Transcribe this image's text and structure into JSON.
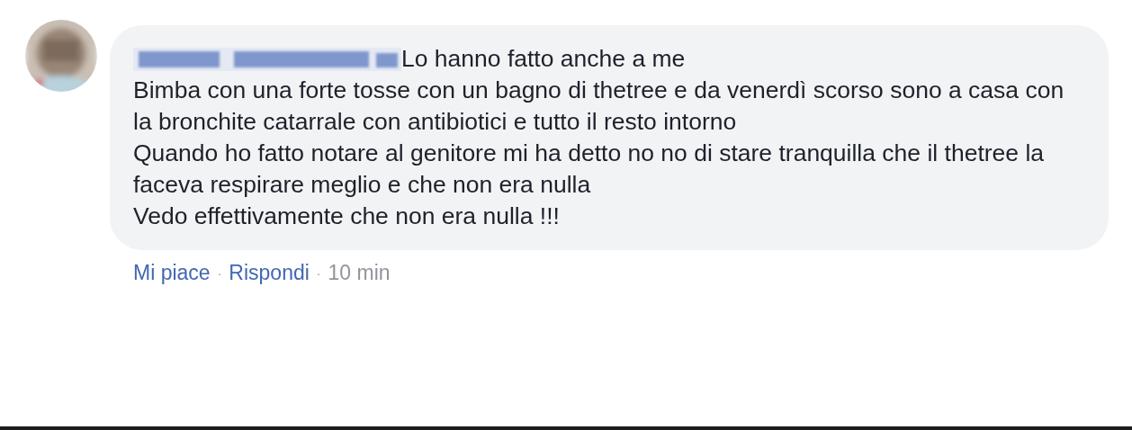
{
  "comment": {
    "author": {
      "kind": "blurred"
    },
    "first_line": "Lo hanno fatto anche a me",
    "paragraphs": [
      "Bimba con una forte tosse con un bagno di thetree e da venerdì scorso sono a casa con la bronchite catarrale con antibiotici e tutto il resto intorno",
      "Quando ho fatto notare al genitore mi ha detto no no di stare tranquilla che il thetree la faceva respirare meglio e che non era nulla",
      "Vedo effettivamente che non era nulla !!!"
    ],
    "actions": [
      {
        "label": "Mi piace",
        "kind": "link"
      },
      {
        "label": "·",
        "kind": "separator"
      },
      {
        "label": "Rispondi",
        "kind": "link"
      },
      {
        "label": "·",
        "kind": "separator"
      },
      {
        "label": "10 min",
        "kind": "time"
      }
    ]
  }
}
